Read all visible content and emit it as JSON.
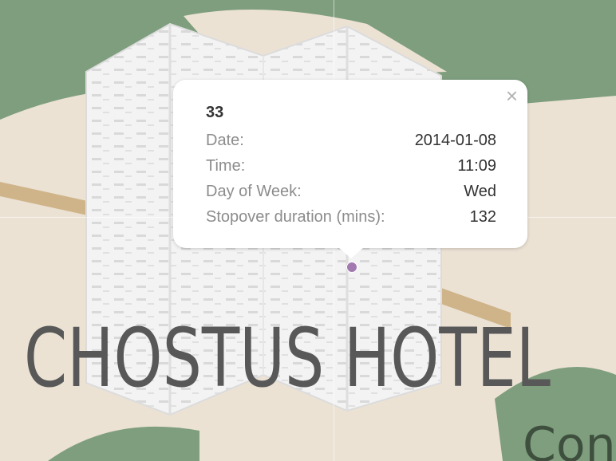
{
  "map": {
    "labels": {
      "hotel": "CHOSTUS HOTEL",
      "corner": "Con"
    },
    "colors": {
      "park": "#7e9e7e",
      "land": "#ebe2d4",
      "road": "#cfb48a",
      "building": "#f2f2f2",
      "marker": "#a27ab0"
    }
  },
  "popup": {
    "title": "33",
    "close_icon": "×",
    "rows": [
      {
        "label": "Date:",
        "value": "2014-01-08"
      },
      {
        "label": "Time:",
        "value": "11:09"
      },
      {
        "label": "Day of Week:",
        "value": "Wed"
      },
      {
        "label": "Stopover duration (mins):",
        "value": "132"
      }
    ]
  }
}
